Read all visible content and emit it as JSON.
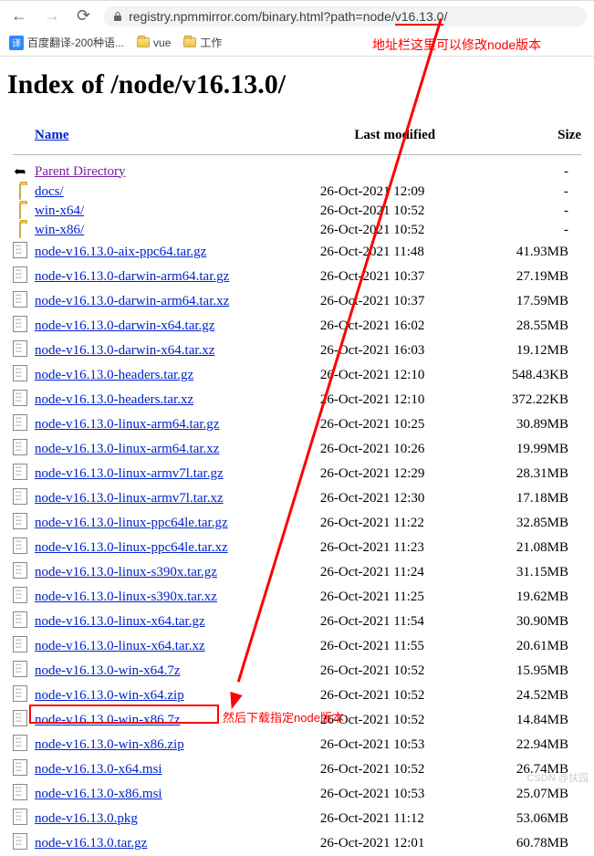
{
  "browser": {
    "url_prefix": "registry.npmmirror.com/binary.html?path=node/",
    "url_highlight": "v16.13.0",
    "url_suffix": "/"
  },
  "bookmarks": {
    "b1": "百度翻译-200种语...",
    "b2": "vue",
    "b3": "工作"
  },
  "annotations": {
    "a1": "地址栏这里可以修改node版本",
    "a2": "然后下载指定node版本"
  },
  "page": {
    "heading": "Index of /node/v16.13.0/",
    "cols": {
      "name": "Name",
      "mod": "Last modified",
      "size": "Size"
    },
    "parent": "Parent Directory"
  },
  "rows": [
    {
      "type": "dir",
      "name": "docs/",
      "mod": "26-Oct-2021 12:09",
      "size": "-"
    },
    {
      "type": "dir",
      "name": "win-x64/",
      "mod": "26-Oct-2021 10:52",
      "size": "-"
    },
    {
      "type": "dir",
      "name": "win-x86/",
      "mod": "26-Oct-2021 10:52",
      "size": "-"
    },
    {
      "type": "file",
      "name": "node-v16.13.0-aix-ppc64.tar.gz",
      "mod": "26-Oct-2021 11:48",
      "size": "41.93MB"
    },
    {
      "type": "file",
      "name": "node-v16.13.0-darwin-arm64.tar.gz",
      "mod": "26-Oct-2021 10:37",
      "size": "27.19MB"
    },
    {
      "type": "file",
      "name": "node-v16.13.0-darwin-arm64.tar.xz",
      "mod": "26-Oct-2021 10:37",
      "size": "17.59MB"
    },
    {
      "type": "file",
      "name": "node-v16.13.0-darwin-x64.tar.gz",
      "mod": "26-Oct-2021 16:02",
      "size": "28.55MB"
    },
    {
      "type": "file",
      "name": "node-v16.13.0-darwin-x64.tar.xz",
      "mod": "26-Oct-2021 16:03",
      "size": "19.12MB"
    },
    {
      "type": "file",
      "name": "node-v16.13.0-headers.tar.gz",
      "mod": "26-Oct-2021 12:10",
      "size": "548.43KB"
    },
    {
      "type": "file",
      "name": "node-v16.13.0-headers.tar.xz",
      "mod": "26-Oct-2021 12:10",
      "size": "372.22KB"
    },
    {
      "type": "file",
      "name": "node-v16.13.0-linux-arm64.tar.gz",
      "mod": "26-Oct-2021 10:25",
      "size": "30.89MB"
    },
    {
      "type": "file",
      "name": "node-v16.13.0-linux-arm64.tar.xz",
      "mod": "26-Oct-2021 10:26",
      "size": "19.99MB"
    },
    {
      "type": "file",
      "name": "node-v16.13.0-linux-armv7l.tar.gz",
      "mod": "26-Oct-2021 12:29",
      "size": "28.31MB"
    },
    {
      "type": "file",
      "name": "node-v16.13.0-linux-armv7l.tar.xz",
      "mod": "26-Oct-2021 12:30",
      "size": "17.18MB"
    },
    {
      "type": "file",
      "name": "node-v16.13.0-linux-ppc64le.tar.gz",
      "mod": "26-Oct-2021 11:22",
      "size": "32.85MB"
    },
    {
      "type": "file",
      "name": "node-v16.13.0-linux-ppc64le.tar.xz",
      "mod": "26-Oct-2021 11:23",
      "size": "21.08MB"
    },
    {
      "type": "file",
      "name": "node-v16.13.0-linux-s390x.tar.gz",
      "mod": "26-Oct-2021 11:24",
      "size": "31.15MB"
    },
    {
      "type": "file",
      "name": "node-v16.13.0-linux-s390x.tar.xz",
      "mod": "26-Oct-2021 11:25",
      "size": "19.62MB"
    },
    {
      "type": "file",
      "name": "node-v16.13.0-linux-x64.tar.gz",
      "mod": "26-Oct-2021 11:54",
      "size": "30.90MB"
    },
    {
      "type": "file",
      "name": "node-v16.13.0-linux-x64.tar.xz",
      "mod": "26-Oct-2021 11:55",
      "size": "20.61MB"
    },
    {
      "type": "file",
      "name": "node-v16.13.0-win-x64.7z",
      "mod": "26-Oct-2021 10:52",
      "size": "15.95MB"
    },
    {
      "type": "file",
      "name": "node-v16.13.0-win-x64.zip",
      "mod": "26-Oct-2021 10:52",
      "size": "24.52MB"
    },
    {
      "type": "file",
      "name": "node-v16.13.0-win-x86.7z",
      "mod": "26-Oct-2021 10:52",
      "size": "14.84MB"
    },
    {
      "type": "file",
      "name": "node-v16.13.0-win-x86.zip",
      "mod": "26-Oct-2021 10:53",
      "size": "22.94MB"
    },
    {
      "type": "file",
      "name": "node-v16.13.0-x64.msi",
      "mod": "26-Oct-2021 10:52",
      "size": "26.74MB"
    },
    {
      "type": "file",
      "name": "node-v16.13.0-x86.msi",
      "mod": "26-Oct-2021 10:53",
      "size": "25.07MB"
    },
    {
      "type": "file",
      "name": "node-v16.13.0.pkg",
      "mod": "26-Oct-2021 11:12",
      "size": "53.06MB"
    },
    {
      "type": "file",
      "name": "node-v16.13.0.tar.gz",
      "mod": "26-Oct-2021 12:01",
      "size": "60.78MB"
    }
  ],
  "watermark": "CSDN @扶园"
}
